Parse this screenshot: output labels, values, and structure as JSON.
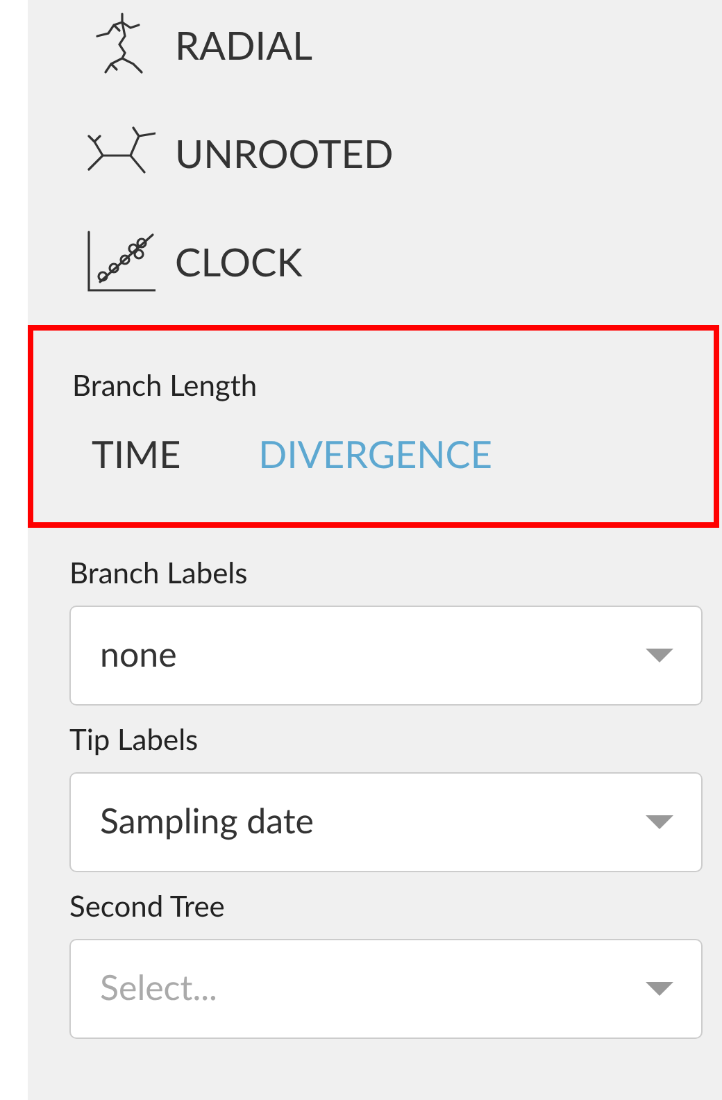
{
  "layouts": [
    {
      "kind": "radial",
      "label": "RADIAL"
    },
    {
      "kind": "unrooted",
      "label": "UNROOTED"
    },
    {
      "kind": "clock",
      "label": "CLOCK"
    }
  ],
  "branch_length": {
    "title": "Branch Length",
    "highlighted": true,
    "options": [
      {
        "label": "TIME",
        "selected": true
      },
      {
        "label": "DIVERGENCE",
        "selected": false
      }
    ]
  },
  "selects": [
    {
      "label": "Branch Labels",
      "value": "none"
    },
    {
      "label": "Tip Labels",
      "value": "Sampling date"
    },
    {
      "label": "Second Tree",
      "placeholder": "Select..."
    }
  ]
}
